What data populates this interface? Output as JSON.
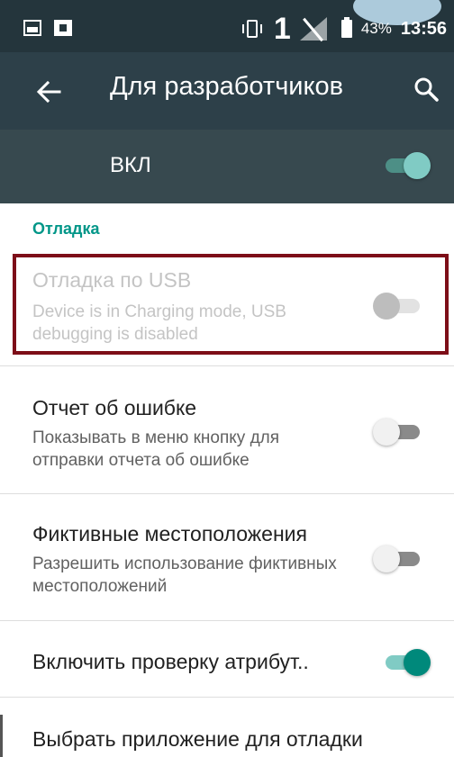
{
  "status_bar": {
    "sim_slot": "1",
    "battery_percent": "43%",
    "time": "13:56"
  },
  "toolbar": {
    "title": "Для разработчиков",
    "back_icon": "arrow-left",
    "search_icon": "magnifier"
  },
  "master_switch": {
    "label": "ВКЛ",
    "checked": true
  },
  "section": {
    "header": "Отладка"
  },
  "preferences": [
    {
      "title": "Отладка по USB",
      "summary": "Device is in Charging mode, USB debugging is disabled",
      "checked": false,
      "enabled": false
    },
    {
      "title": "Отчет об ошибке",
      "summary": "Показывать в меню кнопку для отправки отчета об ошибке",
      "checked": false,
      "enabled": true
    },
    {
      "title": "Фиктивные местоположения",
      "summary": "Разрешить использование фиктивных местоположений",
      "checked": false,
      "enabled": true
    },
    {
      "title": "Включить проверку атрибут..",
      "checked": true,
      "enabled": true
    },
    {
      "title": "Выбрать приложение для отладки",
      "enabled": true
    }
  ],
  "colors": {
    "accent": "#009688",
    "toolbar": "#2d4049",
    "highlight": "#7d0e18"
  }
}
